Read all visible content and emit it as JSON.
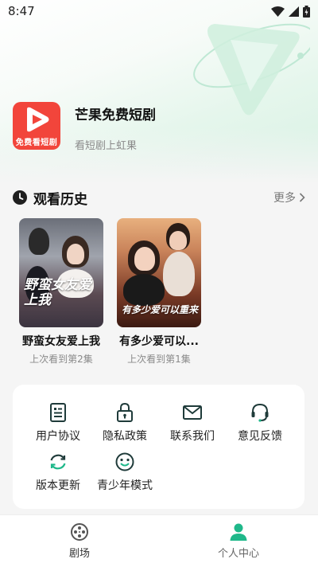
{
  "status_bar": {
    "time": "8:47"
  },
  "app": {
    "name": "芒果免费短剧",
    "slogan": "看短剧上虹果",
    "logo_text": "免费看短剧",
    "logo_color": "#f2453b"
  },
  "history": {
    "title": "观看历史",
    "more_label": "更多",
    "items": [
      {
        "title": "野蛮女友爱上我",
        "cover_text": "野蛮女友爱上我",
        "progress": "上次看到第2集"
      },
      {
        "title": "有多少爱可以...",
        "cover_text": "有多少爱可以重来",
        "progress": "上次看到第1集"
      }
    ]
  },
  "menu": {
    "items": [
      {
        "label": "用户协议",
        "icon": "document-icon"
      },
      {
        "label": "隐私政策",
        "icon": "lock-icon"
      },
      {
        "label": "联系我们",
        "icon": "mail-icon"
      },
      {
        "label": "意见反馈",
        "icon": "headset-icon"
      },
      {
        "label": "版本更新",
        "icon": "refresh-icon"
      },
      {
        "label": "青少年模式",
        "icon": "smile-icon"
      }
    ]
  },
  "tabs": [
    {
      "label": "剧场",
      "icon": "film-reel-icon",
      "active": false
    },
    {
      "label": "个人中心",
      "icon": "person-icon",
      "active": true
    }
  ],
  "colors": {
    "accent": "#1fb88a",
    "icon_dark": "#1f3b3a"
  }
}
